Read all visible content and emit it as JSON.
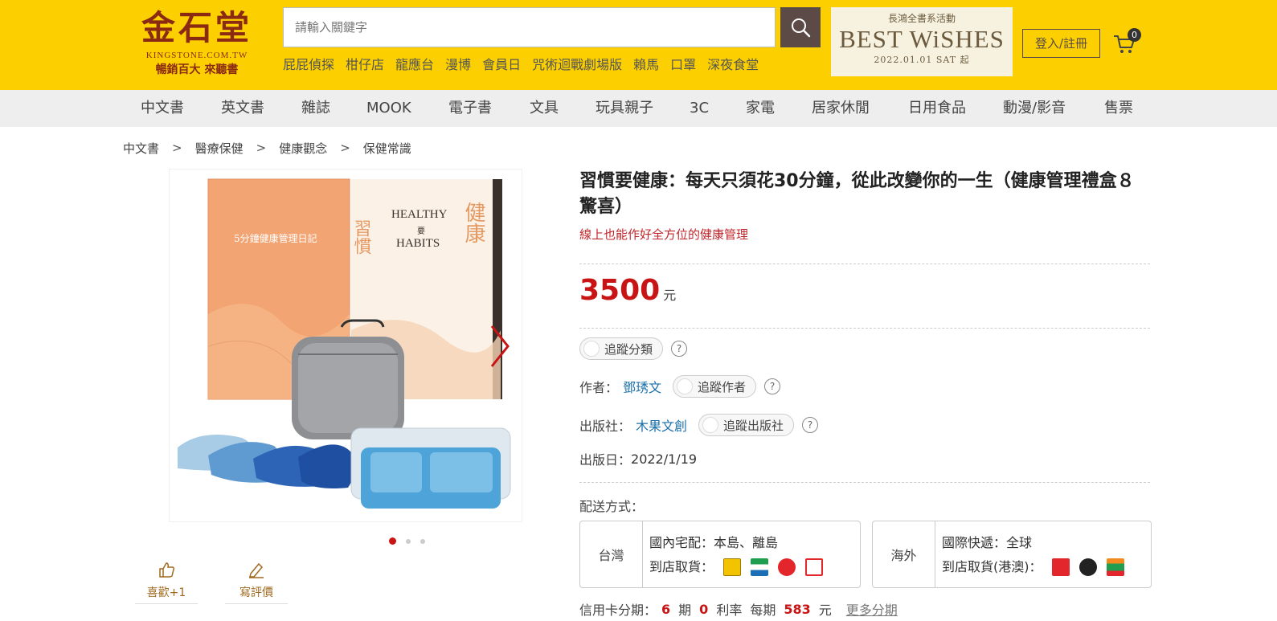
{
  "header": {
    "logo_main": "金石堂",
    "logo_domain": "KINGSTONE.COM.TW",
    "logo_slogan": "暢銷百大 來聽書",
    "search_placeholder": "請輸入關鍵字",
    "hot_keywords": [
      "屁屁偵探",
      "柑仔店",
      "龍應台",
      "漫博",
      "會員日",
      "咒術迴戰劇場版",
      "賴馬",
      "口罩",
      "深夜食堂"
    ],
    "banner_top": "長鴻全書系活動",
    "banner_main": "BEST WiSHES",
    "banner_date": "2022.01.01 SAT 起",
    "login_label": "登入/註冊",
    "cart_count": "0"
  },
  "nav": {
    "categories": [
      "中文書",
      "英文書",
      "雜誌",
      "MOOK",
      "電子書",
      "文具",
      "玩具親子",
      "3C",
      "家電",
      "居家休閒",
      "日用食品",
      "動漫/影音",
      "售票"
    ]
  },
  "breadcrumb": [
    "中文書",
    "醫療保健",
    "健康觀念",
    "保健常識"
  ],
  "gallery": {
    "image_count": 3,
    "active_index": 0,
    "like_label": "喜歡+1",
    "review_label": "寫評價",
    "book1_title": "5分鐘健康管理日記",
    "book2_title_cn_left": "習慣",
    "book2_title_cn_right": "健康",
    "book2_title_en1": "HEALTHY",
    "book2_title_mid": "要",
    "book2_title_en2": "HABITS"
  },
  "product": {
    "title": "習慣要健康：每天只須花30分鐘，從此改變你的一生（健康管理禮盒８驚喜）",
    "subtitle": "線上也能作好全方位的健康管理",
    "price": "3500",
    "price_unit": "元",
    "follow_category_label": "追蹤分類",
    "author_label": "作者：",
    "author": "鄧琇文",
    "follow_author_label": "追蹤作者",
    "publisher_label": "出版社：",
    "publisher": "木果文創",
    "follow_publisher_label": "追蹤出版社",
    "publish_date_label": "出版日：",
    "publish_date": "2022/1/19",
    "help_mark": "?"
  },
  "shipping": {
    "label": "配送方式：",
    "domestic_region": "台灣",
    "domestic_home": "國內宅配：本島、離島",
    "domestic_store": "到店取貨：",
    "overseas_region": "海外",
    "overseas_express": "國際快遞：全球",
    "overseas_store": "到店取貨(港澳)："
  },
  "credit": {
    "label": "信用卡分期：",
    "periods": "6",
    "periods_unit": "期",
    "rate": "0",
    "rate_unit": "利率",
    "each_label": "每期",
    "each_amount": "583",
    "each_unit": "元",
    "more_label": "更多分期"
  },
  "colors": {
    "header_bg": "#fcd000",
    "price_red": "#c81414",
    "link_blue": "#1a6fa8",
    "brand_brown": "#8a2a12"
  }
}
